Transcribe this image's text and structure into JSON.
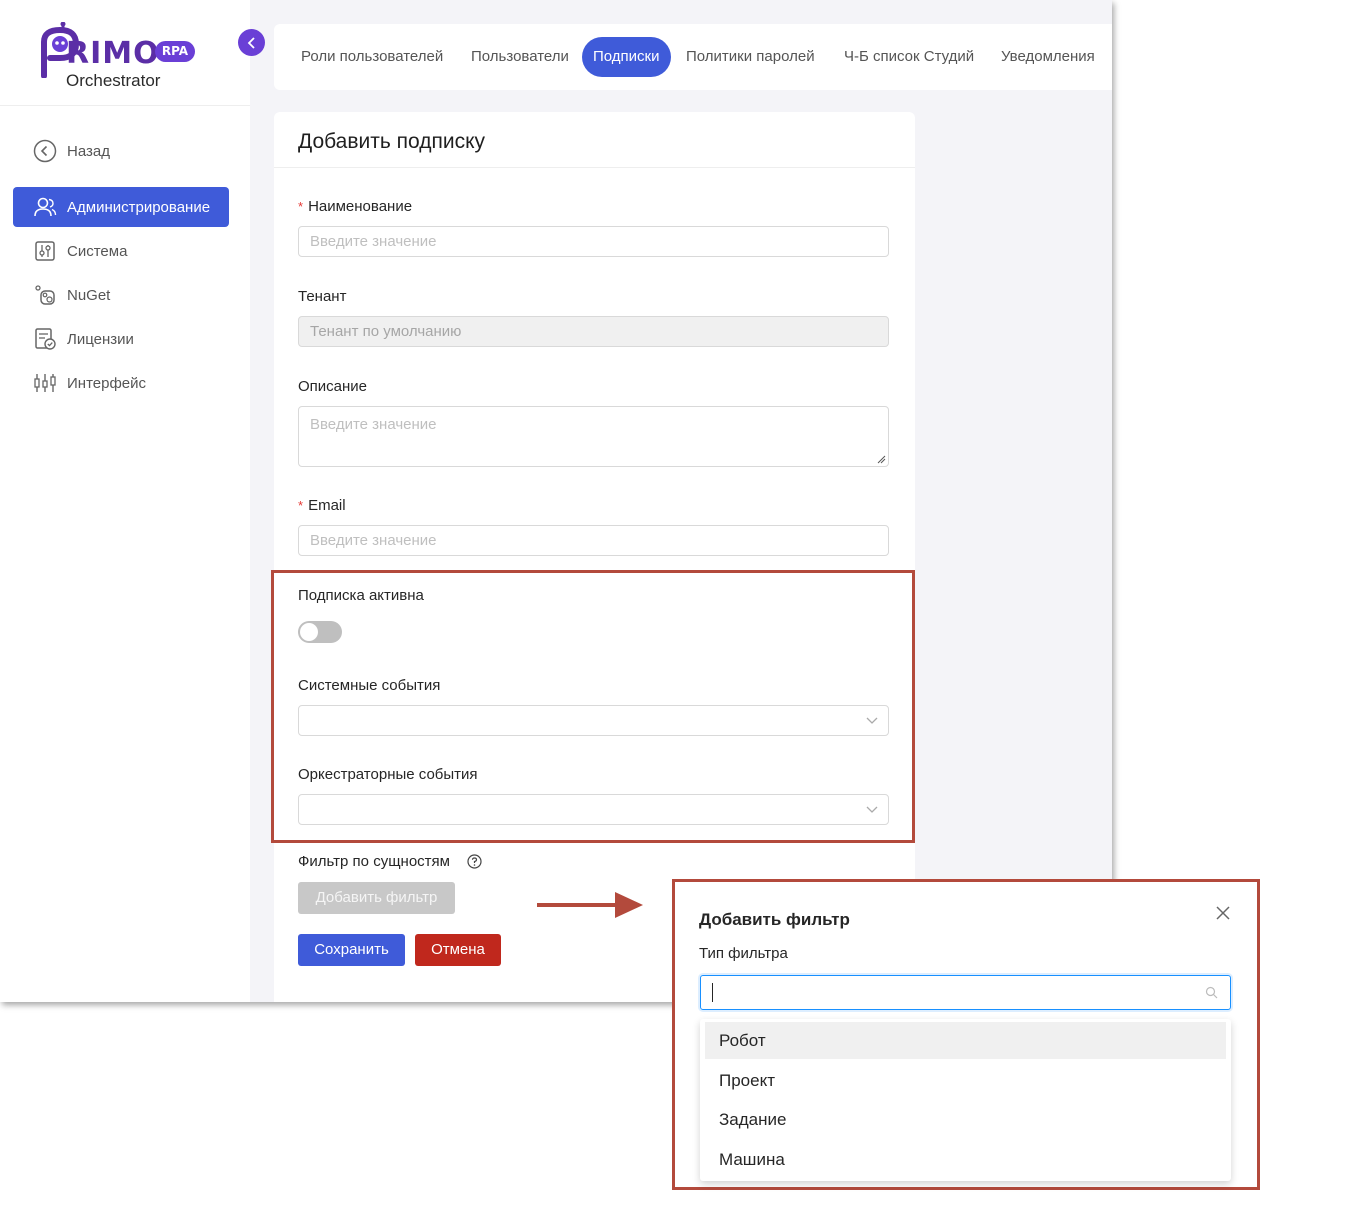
{
  "brand": {
    "logo_text": "RIMO",
    "logo_badge": "RPA",
    "subtitle": "Orchestrator"
  },
  "sidebar": {
    "items": [
      {
        "label": "Назад",
        "icon": "back-circle-icon"
      },
      {
        "label": "Администрирование",
        "icon": "users-icon",
        "active": true
      },
      {
        "label": "Система",
        "icon": "settings-sliders-icon"
      },
      {
        "label": "NuGet",
        "icon": "nuget-icon"
      },
      {
        "label": "Лицензии",
        "icon": "license-icon"
      },
      {
        "label": "Интерфейс",
        "icon": "interface-sliders-icon"
      }
    ]
  },
  "tabs": [
    {
      "label": "Роли пользователей"
    },
    {
      "label": "Пользователи"
    },
    {
      "label": "Подписки",
      "active": true
    },
    {
      "label": "Политики паролей"
    },
    {
      "label": "Ч-Б список Студий"
    },
    {
      "label": "Уведомления"
    }
  ],
  "form": {
    "title": "Добавить подписку",
    "name_label": "Наименование",
    "name_placeholder": "Введите значение",
    "tenant_label": "Тенант",
    "tenant_value": "Тенант по умолчанию",
    "description_label": "Описание",
    "description_placeholder": "Введите значение",
    "email_label": "Email",
    "email_placeholder": "Введите значение",
    "active_label": "Подписка активна",
    "active": false,
    "system_events_label": "Системные события",
    "orchestrator_events_label": "Оркестраторные события",
    "entity_filter_label": "Фильтр по сущностям",
    "add_filter_button": "Добавить фильтр",
    "save_button": "Сохранить",
    "cancel_button": "Отмена",
    "required_mark": "*"
  },
  "modal": {
    "title": "Добавить фильтр",
    "filter_type_label": "Тип фильтра",
    "options": [
      {
        "label": "Робот",
        "highlighted": true
      },
      {
        "label": "Проект"
      },
      {
        "label": "Задание"
      },
      {
        "label": "Машина"
      }
    ]
  },
  "colors": {
    "primary": "#3f5bd9",
    "brand_purple": "#6a3fd6",
    "cancel_red": "#c0281d",
    "highlight_border": "#b34a3c"
  }
}
